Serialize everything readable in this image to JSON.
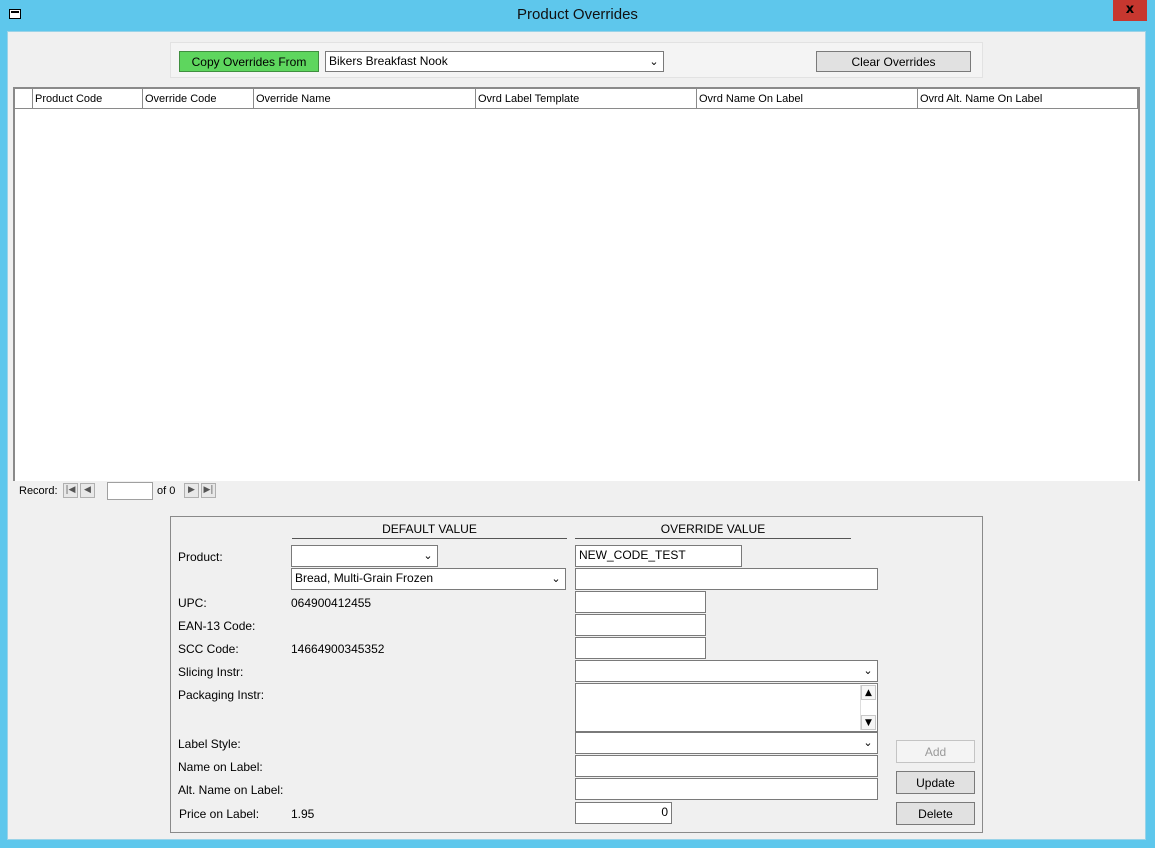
{
  "window": {
    "title": "Product Overrides",
    "close_label": "x"
  },
  "header": {
    "copy_button": "Copy Overrides From",
    "copy_source": "Bikers Breakfast Nook",
    "clear_button": "Clear Overrides"
  },
  "grid": {
    "columns": [
      "Product Code",
      "Override Code",
      "Override Name",
      "Ovrd Label Template",
      "Ovrd Name On Label",
      "Ovrd Alt. Name On Label"
    ],
    "rows": []
  },
  "nav": {
    "record_label": "Record:",
    "current": "",
    "of_label": "of 0"
  },
  "detail": {
    "default_header": "DEFAULT VALUE",
    "override_header": "OVERRIDE VALUE",
    "labels": {
      "product": "Product:",
      "upc": "UPC:",
      "ean": "EAN-13 Code:",
      "scc": "SCC Code:",
      "slicing": "Slicing Instr:",
      "packaging": "Packaging Instr:",
      "label_style": "Label Style:",
      "name_on_label": "Name on Label:",
      "alt_name": "Alt. Name on Label:",
      "price": "Price on Label:"
    },
    "defaults": {
      "product_code": "",
      "product_name": "Bread, Multi-Grain Frozen",
      "upc": "064900412455",
      "ean": "",
      "scc": "14664900345352",
      "price": "1.95"
    },
    "overrides": {
      "product_code": "NEW_CODE_TEST",
      "product_name": "",
      "upc": "",
      "ean": "",
      "scc": "",
      "slicing": "",
      "packaging": "",
      "label_style": "",
      "name_on_label": "",
      "alt_name": "",
      "price": "0"
    },
    "buttons": {
      "add": "Add",
      "update": "Update",
      "delete": "Delete"
    }
  }
}
